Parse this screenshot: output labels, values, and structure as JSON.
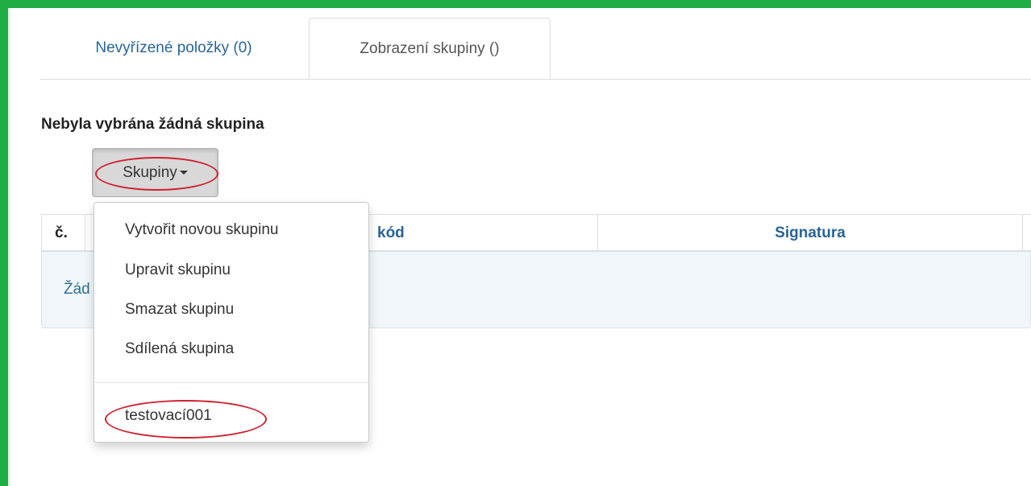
{
  "tabs": [
    {
      "label": "Nevyřízené položky (0)",
      "active": false
    },
    {
      "label": "Zobrazení skupiny ()",
      "active": true
    }
  ],
  "heading": "Nebyla vybrána žádná skupina",
  "group_button": {
    "label": "Skupiny",
    "icon": "caret-down-icon"
  },
  "table": {
    "columns": [
      "č.",
      "kód",
      "Signatura"
    ],
    "empty_text": "Žád"
  },
  "dropdown": {
    "items": [
      "Vytvořit novou skupinu",
      "Upravit skupinu",
      "Smazat skupinu",
      "Sdílená skupina"
    ],
    "groups": [
      "testovací001"
    ]
  },
  "colors": {
    "frame": "#20ad43",
    "link": "#2a6496",
    "annotation": "#d0202e",
    "info_bg": "#f0f6fa"
  }
}
